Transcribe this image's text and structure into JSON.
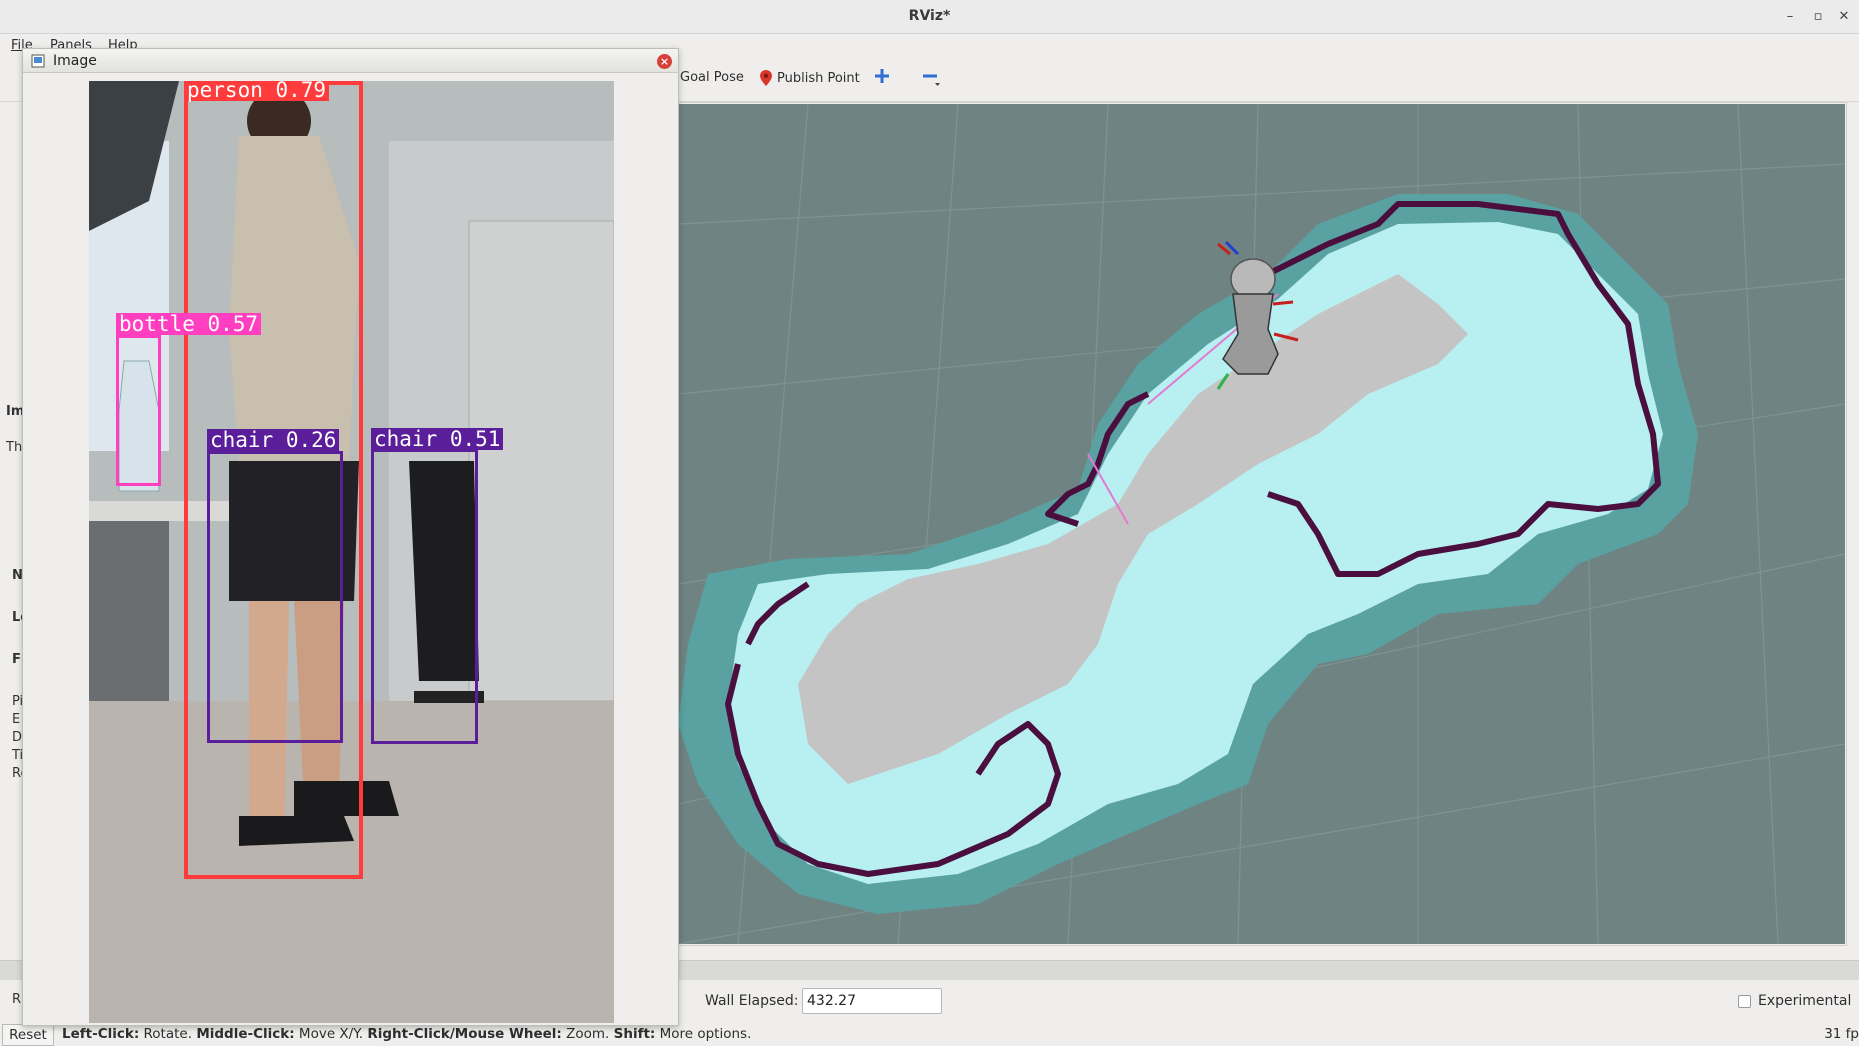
{
  "window": {
    "title": "RViz*"
  },
  "menu": [
    "File",
    "Panels",
    "Help"
  ],
  "toolbar": {
    "goal_pose": "Goal Pose",
    "publish_point": "Publish Point"
  },
  "left_fragments": [
    "Im",
    "Th",
    "N",
    "Le",
    "Fi",
    "Pi",
    "E",
    "D",
    "Ti",
    "Re",
    "R"
  ],
  "image_window": {
    "title": "Image",
    "detections": [
      {
        "label": "person 0.79",
        "color": "#ff3b3b"
      },
      {
        "label": "bottle 0.57",
        "color": "#ff3fbf"
      },
      {
        "label": "chair 0.26",
        "color": "#5a1e9a"
      },
      {
        "label": "chair 0.51",
        "color": "#5a1e9a"
      }
    ]
  },
  "time_panel": {
    "wall_elapsed_label": "Wall Elapsed:",
    "wall_elapsed_value": "432.27",
    "experimental_label": "Experimental",
    "experimental_checked": false
  },
  "status": {
    "reset_label": "Reset",
    "hint_parts": [
      {
        "bold": "Left-Click:",
        "text": " Rotate. "
      },
      {
        "bold": "Middle-Click:",
        "text": " Move X/Y. "
      },
      {
        "bold": "Right-Click/Mouse Wheel:",
        "text": ":: Zoom. "
      },
      {
        "bold": "Shift:",
        "text": " More options."
      }
    ],
    "fps": "31 fp"
  },
  "colors": {
    "map_free": "#c4c4c4",
    "map_inflation": "#b8eff0",
    "map_costmap_outer": "#5aa2a1",
    "map_obstacle": "#4a0f3f",
    "viewport_bg": "#6f8482"
  }
}
